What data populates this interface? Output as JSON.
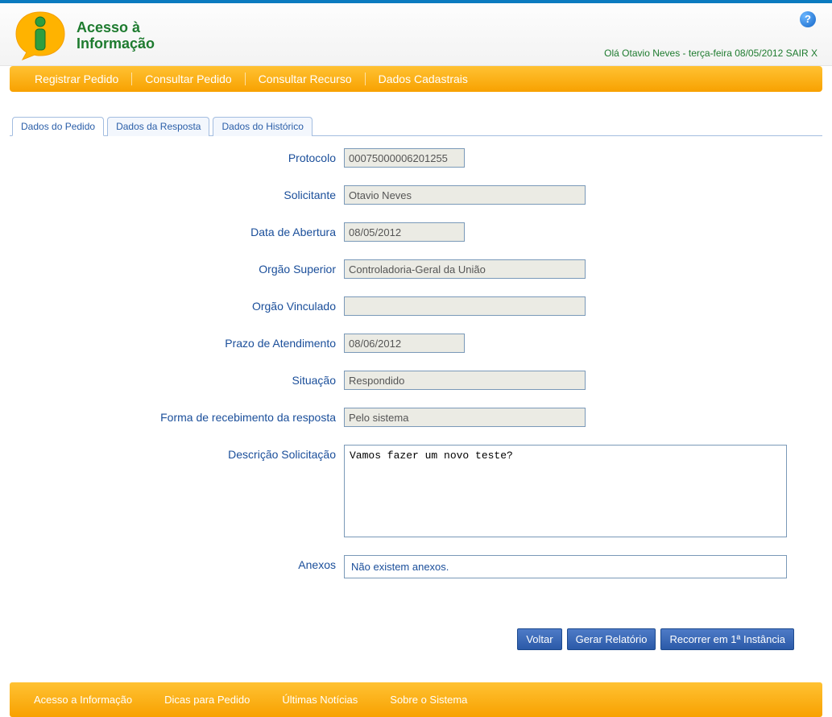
{
  "brand": {
    "line1": "Acesso à",
    "line2": "Informação"
  },
  "header": {
    "greeting": "Olá Otavio Neves - terça-feira 08/05/2012 ",
    "logout": "SAIR",
    "logout_x": "X",
    "help": "?"
  },
  "nav": {
    "registrar": "Registrar Pedido",
    "consultar_pedido": "Consultar Pedido",
    "consultar_recurso": "Consultar Recurso",
    "dados_cadastrais": "Dados Cadastrais"
  },
  "tabs": {
    "dados_pedido": "Dados do Pedido",
    "dados_resposta": "Dados da Resposta",
    "dados_historico": "Dados do Histórico"
  },
  "labels": {
    "protocolo": "Protocolo",
    "solicitante": "Solicitante",
    "data_abertura": "Data de Abertura",
    "orgao_superior": "Orgão Superior",
    "orgao_vinculado": "Orgão Vinculado",
    "prazo": "Prazo de Atendimento",
    "situacao": "Situação",
    "forma": "Forma de recebimento da resposta",
    "descricao": "Descrição Solicitação",
    "anexos": "Anexos"
  },
  "values": {
    "protocolo": "00075000006201255",
    "solicitante": "Otavio Neves",
    "data_abertura": "08/05/2012",
    "orgao_superior": "Controladoria-Geral da União",
    "orgao_vinculado": "",
    "prazo": "08/06/2012",
    "situacao": "Respondido",
    "forma": "Pelo sistema",
    "descricao": "Vamos fazer um novo teste?",
    "anexos": "Não existem anexos."
  },
  "buttons": {
    "voltar": "Voltar",
    "gerar": "Gerar Relatório",
    "recorrer": "Recorrer em 1ª Instância"
  },
  "footer": {
    "acesso": "Acesso a Informação",
    "dicas": "Dicas para Pedido",
    "noticias": "Últimas Notícias",
    "sobre": "Sobre o Sistema"
  }
}
